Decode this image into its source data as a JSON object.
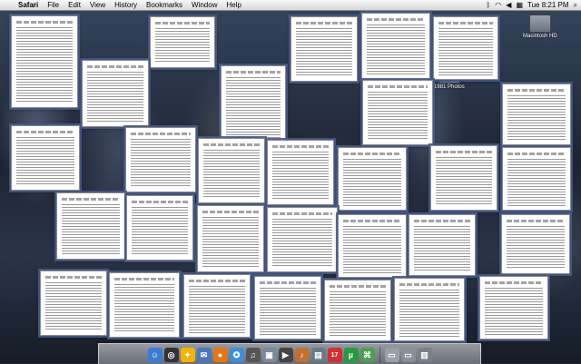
{
  "menubar": {
    "apple_glyph": "",
    "app": "Safari",
    "items": [
      "File",
      "Edit",
      "View",
      "History",
      "Bookmarks",
      "Window",
      "Help"
    ],
    "clock": "Tue 8:21 PM"
  },
  "desktop_icons": [
    {
      "label": "Macintosh HD"
    },
    {
      "label": "1981 Photos"
    }
  ],
  "documents": [
    {
      "id": 1
    },
    {
      "id": 2
    },
    {
      "id": 3
    },
    {
      "id": 4
    },
    {
      "id": 5
    },
    {
      "id": 6
    },
    {
      "id": 7
    },
    {
      "id": 8
    }
  ],
  "dock": {
    "apps": [
      {
        "name": "finder",
        "glyph": "☺",
        "color": "#3b7bd5"
      },
      {
        "name": "dashboard",
        "glyph": "◎",
        "color": "#333333"
      },
      {
        "name": "aim",
        "glyph": "✦",
        "color": "#f2b400"
      },
      {
        "name": "mail",
        "glyph": "✉",
        "color": "#4a78b8"
      },
      {
        "name": "firefox",
        "glyph": "●",
        "color": "#e2771a"
      },
      {
        "name": "safari",
        "glyph": "✪",
        "color": "#3d8fd8"
      },
      {
        "name": "itunes",
        "glyph": "♫",
        "color": "#555555"
      },
      {
        "name": "iphoto",
        "glyph": "▣",
        "color": "#7a8a9a"
      },
      {
        "name": "imovie",
        "glyph": "▶",
        "color": "#444444"
      },
      {
        "name": "garageband",
        "glyph": "♪",
        "color": "#c07030"
      },
      {
        "name": "preview",
        "glyph": "▤",
        "color": "#6a7a8a"
      },
      {
        "name": "ical",
        "glyph": "17",
        "color": "#d03030"
      },
      {
        "name": "utorrent",
        "glyph": "µ",
        "color": "#2a9a3a"
      },
      {
        "name": "mercury",
        "glyph": "⌘",
        "color": "#4aa050"
      }
    ],
    "docs": [
      {
        "name": "documents-stack",
        "glyph": "▭",
        "color": "#9aa0a8"
      },
      {
        "name": "downloads-stack",
        "glyph": "▭",
        "color": "#8a9098"
      },
      {
        "name": "trash",
        "glyph": "▥",
        "color": "#7a8088"
      }
    ]
  }
}
